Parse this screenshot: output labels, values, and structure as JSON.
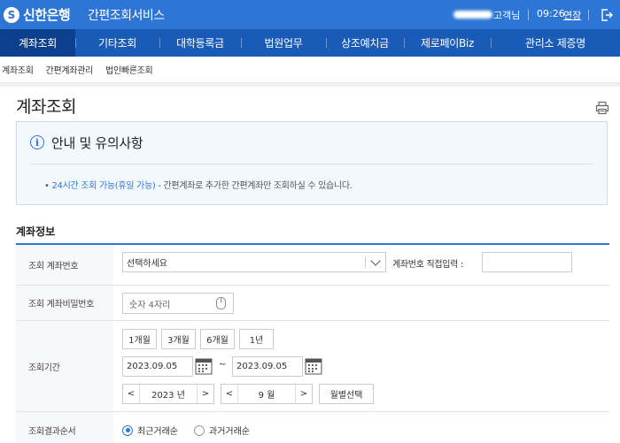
{
  "header": {
    "logo_mark": "S",
    "logo_text": "신한은행",
    "service_title": "간편조회서비스",
    "user_suffix": "고객님",
    "time": "09:26",
    "extend_label": "연장"
  },
  "nav": {
    "items": [
      {
        "label": "계좌조회",
        "active": true
      },
      {
        "label": "기타조회"
      },
      {
        "label": "대학등록금"
      },
      {
        "label": "법원업무"
      },
      {
        "label": "상조예치금"
      },
      {
        "label": "제로페이Biz"
      },
      {
        "label": "관리소 제증명"
      }
    ]
  },
  "subnav": {
    "items": [
      "계좌조회",
      "간편계좌관리",
      "법인빠른조회"
    ]
  },
  "page": {
    "title": "계좌조회"
  },
  "notice": {
    "title": "안내 및 유의사항",
    "bullet": "•",
    "highlight": "24시간 조회 가능(휴일 가능)",
    "text": " - 간편계좌로 추가한 간편계좌만 조회하실 수 있습니다."
  },
  "section": {
    "title": "계좌정보"
  },
  "form": {
    "account": {
      "label": "조회 계좌번호",
      "select_value": "선택하세요",
      "direct_label": "계좌번호 직접입력 :",
      "direct_value": ""
    },
    "password": {
      "label": "조회 계좌비밀번호",
      "placeholder": "숫자 4자리"
    },
    "period": {
      "label": "조회기간",
      "quick_buttons": [
        "1개월",
        "3개월",
        "6개월",
        "1년"
      ],
      "start_date": "2023.09.05",
      "tilde": "~",
      "end_date": "2023.09.05",
      "year_value": "2023 년",
      "month_value": "9 월",
      "prev_arrow": "<",
      "next_arrow": ">",
      "month_select_label": "월별선택"
    },
    "order": {
      "label": "조회결과순서",
      "options": [
        {
          "label": "최근거래순",
          "selected": true
        },
        {
          "label": "과거거래순",
          "selected": false
        }
      ]
    }
  },
  "colors": {
    "header_bg": "#2e76d6",
    "nav_bg": "#1b5bb8",
    "nav_active": "#0c3f8e",
    "accent": "#2e76d6"
  }
}
